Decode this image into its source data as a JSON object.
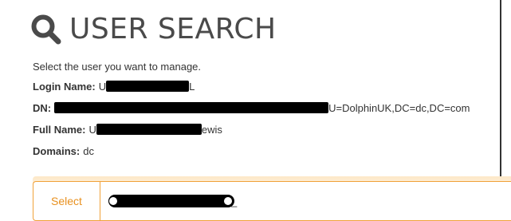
{
  "header": {
    "title": "USER SEARCH",
    "icon": "search-icon"
  },
  "instructions": "Select the user you want to manage.",
  "user": {
    "login_label": "Login Name:",
    "login_prefix": "U",
    "login_suffix": "L",
    "dn_label": "DN:",
    "dn_suffix": "U=DolphinUK,DC=dc,DC=com",
    "fullname_label": "Full Name:",
    "fullname_prefix": "U",
    "fullname_suffix": "ewis",
    "domains_label": "Domains:",
    "domains_value": "dc"
  },
  "selector": {
    "button_label": "Select",
    "input_tail": "_"
  },
  "colors": {
    "accent": "#e8901e",
    "accent_border": "#f0a23a",
    "title": "#4a4a4a",
    "redaction": "#000000"
  }
}
